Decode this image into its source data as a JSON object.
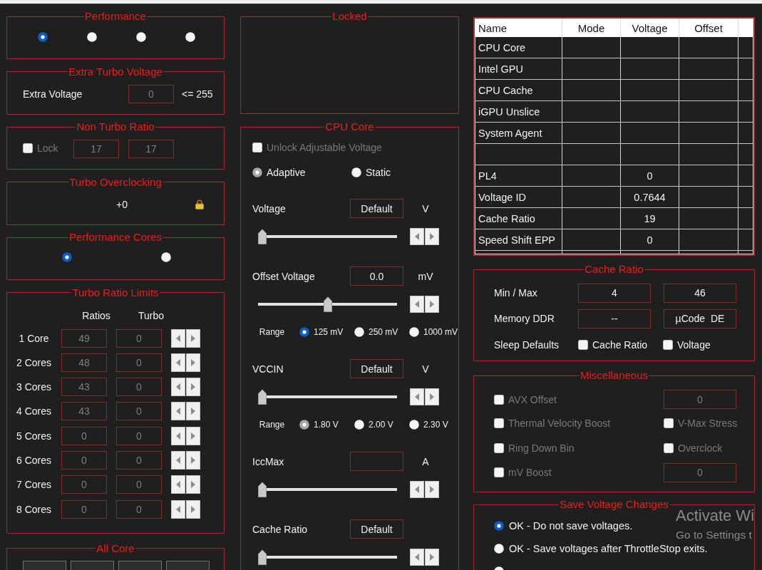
{
  "performance": {
    "title": "Performance",
    "options": [
      {
        "selected": true
      },
      {
        "selected": false
      },
      {
        "selected": false
      },
      {
        "selected": false
      }
    ]
  },
  "extra_turbo_voltage": {
    "title": "Extra Turbo Voltage",
    "label": "Extra Voltage",
    "value": "0",
    "disabled": true,
    "limit": "<= 255"
  },
  "non_turbo_ratio": {
    "title": "Non Turbo Ratio",
    "lock": {
      "label": "Lock",
      "checked": false,
      "disabled": true
    },
    "fields": [
      {
        "value": "17",
        "disabled": true
      },
      {
        "value": "17",
        "disabled": true
      }
    ]
  },
  "turbo_overclocking": {
    "title": "Turbo Overclocking",
    "value": "+0",
    "locked": true
  },
  "performance_cores": {
    "title": "Performance Cores",
    "options": [
      {
        "selected": true
      },
      {
        "selected": false
      }
    ]
  },
  "turbo_ratio_limits": {
    "title": "Turbo Ratio Limits",
    "columns": [
      "Ratios",
      "Turbo"
    ],
    "disabled": true,
    "rows": [
      {
        "label": "1 Core",
        "ratio": "49",
        "turbo": "0"
      },
      {
        "label": "2 Cores",
        "ratio": "48",
        "turbo": "0"
      },
      {
        "label": "3 Cores",
        "ratio": "43",
        "turbo": "0"
      },
      {
        "label": "4 Cores",
        "ratio": "43",
        "turbo": "0"
      },
      {
        "label": "5 Cores",
        "ratio": "0",
        "turbo": "0"
      },
      {
        "label": "6 Cores",
        "ratio": "0",
        "turbo": "0"
      },
      {
        "label": "7 Cores",
        "ratio": "0",
        "turbo": "0"
      },
      {
        "label": "8 Cores",
        "ratio": "0",
        "turbo": "0"
      }
    ]
  },
  "all_core": {
    "title": "All Core",
    "buttons": [
      {
        "disabled": true
      },
      {
        "disabled": true
      },
      {
        "disabled": true
      },
      {
        "disabled": true
      }
    ]
  },
  "locked": {
    "title": "Locked"
  },
  "cpu_core": {
    "title": "CPU Core",
    "controls": [
      {
        "kind": "checkbox",
        "label": "Unlock Adjustable Voltage",
        "checked": false,
        "disabled": true
      },
      {
        "kind": "mode",
        "disabled": true,
        "options": [
          {
            "label": "Adaptive",
            "selected": true
          },
          {
            "label": "Static",
            "selected": false
          }
        ]
      },
      {
        "kind": "value",
        "label": "Voltage",
        "value": "Default",
        "unit": "V"
      },
      {
        "kind": "slider",
        "level": 0
      },
      {
        "kind": "value",
        "label": "Offset Voltage",
        "value": "0.0",
        "unit": "mV"
      },
      {
        "kind": "slider",
        "level": 0.5
      },
      {
        "kind": "range",
        "label": "Range",
        "disabled": false,
        "options": [
          {
            "label": "125 mV",
            "selected": true
          },
          {
            "label": "250 mV",
            "selected": false
          },
          {
            "label": "1000 mV",
            "selected": false
          }
        ]
      },
      {
        "kind": "value",
        "label": "VCCIN",
        "value": "Default",
        "unit": "V"
      },
      {
        "kind": "slider",
        "level": 0
      },
      {
        "kind": "range",
        "label": "Range",
        "disabled": true,
        "options": [
          {
            "label": "1.80 V",
            "selected": true
          },
          {
            "label": "2.00 V",
            "selected": false
          },
          {
            "label": "2.30 V",
            "selected": false
          }
        ]
      },
      {
        "kind": "value",
        "label": "IccMax",
        "unit": "A"
      },
      {
        "kind": "slider",
        "level": 0
      },
      {
        "kind": "value",
        "label": "Cache Ratio",
        "value": "Default"
      },
      {
        "kind": "slider",
        "level": 0
      }
    ]
  },
  "voltage_table": {
    "columns": [
      "Name",
      "Mode",
      "Voltage",
      "Offset"
    ],
    "rows": [
      {
        "name": "CPU Core"
      },
      {
        "name": "Intel GPU"
      },
      {
        "name": "CPU Cache"
      },
      {
        "name": "iGPU Unslice"
      },
      {
        "name": "System Agent"
      },
      {},
      {
        "name": "PL4",
        "voltage": "0"
      },
      {
        "name": "Voltage ID",
        "voltage": "0.7644"
      },
      {
        "name": "Cache Ratio",
        "voltage": "19"
      },
      {
        "name": "Speed Shift EPP",
        "voltage": "0"
      }
    ]
  },
  "cache_ratio": {
    "title": "Cache Ratio",
    "rows": [
      {
        "label": "Min / Max",
        "fields": [
          {
            "value": "4"
          },
          {
            "value": "46"
          }
        ]
      },
      {
        "label": "Memory DDR",
        "fields": [
          {
            "value": "--"
          },
          {
            "value": "µCode  DE"
          }
        ]
      }
    ],
    "sleep_defaults": {
      "label": "Sleep Defaults",
      "options": [
        {
          "label": "Cache Ratio",
          "checked": false
        },
        {
          "label": "Voltage",
          "checked": false
        }
      ]
    }
  },
  "miscellaneous": {
    "title": "Miscellaneous",
    "rows": [
      {
        "left": {
          "label": "AVX Offset",
          "checked": false,
          "disabled": true
        },
        "right": {
          "kind": "field",
          "value": "0",
          "disabled": true
        }
      },
      {
        "left": {
          "label": "Thermal Velocity Boost",
          "checked": false,
          "disabled": true
        },
        "right": {
          "kind": "checkbox",
          "label": "V-Max Stress",
          "checked": false,
          "disabled": true
        }
      },
      {
        "left": {
          "label": "Ring Down Bin",
          "checked": false,
          "disabled": true
        },
        "right": {
          "kind": "checkbox",
          "label": "Overclock",
          "checked": false,
          "disabled": true
        }
      },
      {
        "left": {
          "label": "mV Boost",
          "checked": false,
          "disabled": true
        },
        "right": {
          "kind": "field",
          "value": "0",
          "disabled": true
        }
      }
    ]
  },
  "save_voltage_changes": {
    "title": "Save Voltage Changes",
    "options": [
      {
        "label": "OK - Do not save voltages.",
        "selected": true
      },
      {
        "label": "OK - Save voltages after ThrottleStop exits.",
        "selected": false
      },
      {
        "selected": false
      }
    ]
  },
  "system_watermark": {
    "title": "Activate Wi",
    "subtitle": "Go to Settings t"
  }
}
